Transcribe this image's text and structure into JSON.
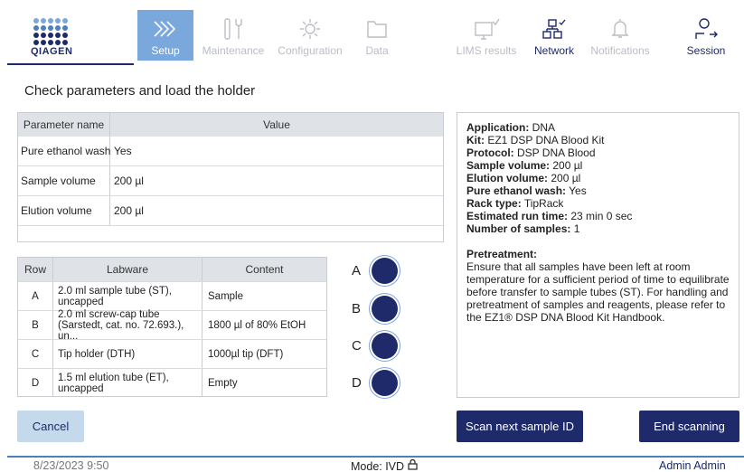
{
  "header": {
    "logo_text": "QIAGEN",
    "nav": [
      {
        "label": "Setup",
        "icon": "chevrons-right-icon",
        "state": "active"
      },
      {
        "label": "Maintenance",
        "icon": "tools-icon",
        "state": "disabled"
      },
      {
        "label": "Configuration",
        "icon": "gear-icon",
        "state": "disabled"
      },
      {
        "label": "Data",
        "icon": "folder-icon",
        "state": "disabled"
      },
      {
        "label": "LIMS results",
        "icon": "monitor-check-icon",
        "state": "disabled"
      },
      {
        "label": "Network",
        "icon": "network-check-icon",
        "state": "enabled"
      },
      {
        "label": "Notifications",
        "icon": "bell-icon",
        "state": "disabled"
      },
      {
        "label": "Session",
        "icon": "user-logout-icon",
        "state": "enabled"
      }
    ]
  },
  "page_title": "Check parameters and load the holder",
  "parameters": {
    "headers": [
      "Parameter name",
      "Value"
    ],
    "rows": [
      {
        "name": "Pure ethanol wash",
        "value": "Yes"
      },
      {
        "name": "Sample volume",
        "value": "200 µl"
      },
      {
        "name": "Elution volume",
        "value": "200 µl"
      }
    ]
  },
  "labware": {
    "headers": [
      "Row",
      "Labware",
      "Content"
    ],
    "rows": [
      {
        "row": "A",
        "labware": "2.0 ml sample tube (ST), uncapped",
        "content": "Sample"
      },
      {
        "row": "B",
        "labware": "2.0 ml screw-cap tube (Sarstedt, cat. no. 72.693.), un...",
        "content": "1800 µl of 80% EtOH"
      },
      {
        "row": "C",
        "labware": "Tip holder (DTH)",
        "content": "1000µl tip (DFT)"
      },
      {
        "row": "D",
        "labware": "1.5 ml elution tube (ET), uncapped",
        "content": "Empty"
      }
    ]
  },
  "rack_positions": [
    "A",
    "B",
    "C",
    "D"
  ],
  "info": {
    "application_label": "Application:",
    "application": "DNA",
    "kit_label": "Kit:",
    "kit": "EZ1 DSP DNA Blood Kit",
    "protocol_label": "Protocol:",
    "protocol": "DSP DNA Blood",
    "sample_volume_label": "Sample volume:",
    "sample_volume": "200 µl",
    "elution_volume_label": "Elution volume:",
    "elution_volume": "200 µl",
    "ethanol_label": "Pure ethanol wash:",
    "ethanol": "Yes",
    "rack_label": "Rack type:",
    "rack": "TipRack",
    "runtime_label": "Estimated run time:",
    "runtime": "23 min 0 sec",
    "samples_label": "Number of samples:",
    "samples": "1",
    "pretreatment_label": "Pretreatment:",
    "pretreatment_text": "Ensure that all samples have been left at room temperature for a sufficient period of time to equilibrate before transfer to sample tubes (ST). For handling and pretreatment of samples and reagents, please refer to the EZ1® DSP DNA Blood Kit Handbook."
  },
  "buttons": {
    "cancel": "Cancel",
    "scan_next": "Scan next sample ID",
    "end_scanning": "End scanning"
  },
  "footer": {
    "datetime": "8/23/2023 9:50",
    "mode": "Mode: IVD",
    "user": "Admin Admin"
  },
  "colors": {
    "brand_dark": "#1f2a6b",
    "brand_light": "#7aa7dc",
    "disabled": "#b9bdc4"
  }
}
